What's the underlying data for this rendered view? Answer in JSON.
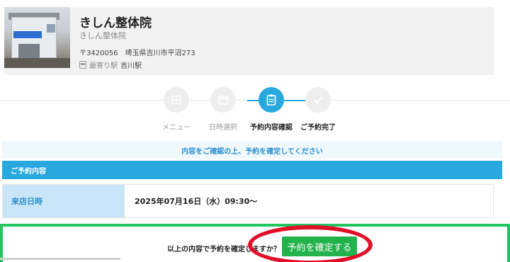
{
  "shop": {
    "name": "きしん整体院",
    "subtitle": "きしん整体院",
    "address": "〒3420056　埼玉県吉川市平沼273",
    "station_label": "最寄り駅",
    "station_name": "吉川駅"
  },
  "steps": [
    {
      "label": "メニュー",
      "state": "inactive"
    },
    {
      "label": "日時選択",
      "state": "inactive"
    },
    {
      "label": "予約内容確認",
      "state": "active"
    },
    {
      "label": "ご予約完了",
      "state": "done"
    }
  ],
  "notice": "内容をご確認の上、予約を確定してください",
  "section_title": "ご予約内容",
  "details": [
    {
      "label": "来店日時",
      "value": "2025年07月16日（水）09:30〜"
    }
  ],
  "confirm": {
    "prompt": "以上の内容で予約を確定しますか？",
    "button_label": "予約を確定する"
  },
  "colors": {
    "accent": "#29a8e0",
    "confirm_green": "#22b24c",
    "highlight_red": "#e0102a"
  }
}
